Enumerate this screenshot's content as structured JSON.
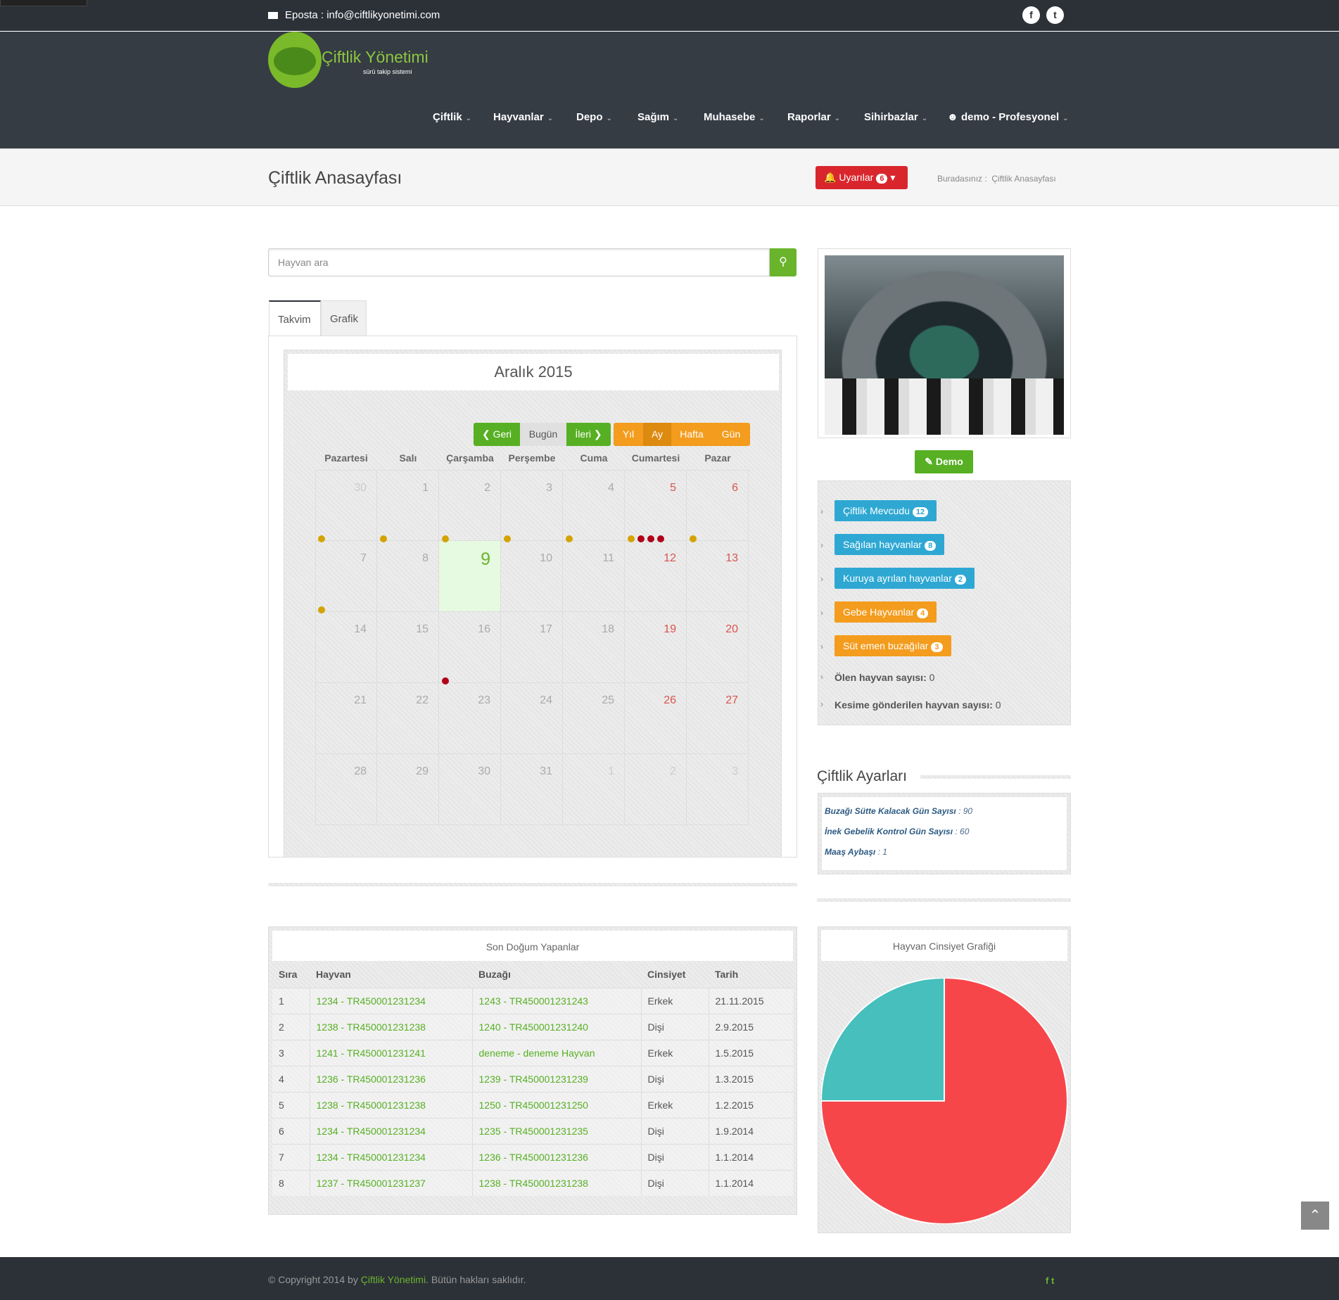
{
  "topbar": {
    "email_label": "Eposta : info@ciftlikyonetimi.com",
    "social": [
      "f",
      "t"
    ]
  },
  "logo": {
    "title": "Çiftlik Yönetimi",
    "subtitle": "sürü takip sistemi"
  },
  "nav": {
    "items": [
      {
        "label": "Çiftlik"
      },
      {
        "label": "Hayvanlar"
      },
      {
        "label": "Depo"
      },
      {
        "label": "Sağım"
      },
      {
        "label": "Muhasebe"
      },
      {
        "label": "Raporlar"
      },
      {
        "label": "Sihirbazlar"
      },
      {
        "label": "demo - Profesyonel"
      }
    ]
  },
  "subheader": {
    "page_title": "Çiftlik Anasayfası",
    "alerts_label": "Uyarılar",
    "alerts_count": "6",
    "breadcrumb_prefix": "Buradasınız :",
    "breadcrumb_current": "Çiftlik Anasayfası"
  },
  "search": {
    "placeholder": "Hayvan ara"
  },
  "tabs": [
    {
      "label": "Takvim"
    },
    {
      "label": "Grafik"
    }
  ],
  "calendar": {
    "title": "Aralık 2015",
    "nav_buttons": {
      "prev": "Geri",
      "today": "Bugün",
      "next": "İleri"
    },
    "view_buttons": {
      "year": "Yıl",
      "month": "Ay",
      "week": "Hafta",
      "day": "Gün"
    },
    "weekdays": [
      "Pazartesi",
      "Salı",
      "Çarşamba",
      "Perşembe",
      "Cuma",
      "Cumartesi",
      "Pazar"
    ],
    "weeks": [
      [
        "30",
        "1",
        "2",
        "3",
        "4",
        "5",
        "6"
      ],
      [
        "7",
        "8",
        "9",
        "10",
        "11",
        "12",
        "13"
      ],
      [
        "14",
        "15",
        "16",
        "17",
        "18",
        "19",
        "20"
      ],
      [
        "21",
        "22",
        "23",
        "24",
        "25",
        "26",
        "27"
      ],
      [
        "28",
        "29",
        "30",
        "31",
        "1",
        "2",
        "3"
      ]
    ],
    "today": "9"
  },
  "right_panel": {
    "demo_button": "Demo",
    "stats": [
      {
        "label": "Çiftlik Mevcudu",
        "count": "12"
      },
      {
        "label": "Sağılan hayvanlar",
        "count": "8"
      },
      {
        "label": "Kuruya ayrılan hayvanlar",
        "count": "2"
      },
      {
        "label": "Gebe Hayvanlar",
        "count": "4"
      },
      {
        "label": "Süt emen buzağılar",
        "count": "3"
      }
    ],
    "dead_label": "Ölen hayvan sayısı:",
    "dead_value": "0",
    "slaughter_label": "Kesime gönderilen hayvan sayısı:",
    "slaughter_value": "0",
    "colors": {
      "blue": "#2ea8d3",
      "orange": "#f39c1d",
      "green": "#57b023"
    }
  },
  "settings": {
    "title": "Çiftlik Ayarları",
    "items": [
      {
        "label": "Buzağı Sütte Kalacak Gün Sayısı",
        "value": ": 90"
      },
      {
        "label": "İnek Gebelik Kontrol Gün Sayısı",
        "value": ": 60"
      },
      {
        "label": "Maaş Aybaşı",
        "value": ": 1"
      }
    ]
  },
  "births": {
    "title": "Son Doğum Yapanlar",
    "columns": [
      "Sıra",
      "Hayvan",
      "Buzağı",
      "Cinsiyet",
      "Tarih"
    ],
    "rows": [
      [
        "1",
        "1234 - TR450001231234",
        "1243 - TR450001231243",
        "Erkek",
        "21.11.2015"
      ],
      [
        "2",
        "1238 - TR450001231238",
        "1240 - TR450001231240",
        "Dişi",
        "2.9.2015"
      ],
      [
        "3",
        "1241 - TR450001231241",
        "deneme - deneme Hayvan",
        "Erkek",
        "1.5.2015"
      ],
      [
        "4",
        "1236 - TR450001231236",
        "1239 - TR450001231239",
        "Dişi",
        "1.3.2015"
      ],
      [
        "5",
        "1238 - TR450001231238",
        "1250 - TR450001231250",
        "Erkek",
        "1.2.2015"
      ],
      [
        "6",
        "1234 - TR450001231234",
        "1235 - TR450001231235",
        "Dişi",
        "1.9.2014"
      ],
      [
        "7",
        "1234 - TR450001231234",
        "1236 - TR450001231236",
        "Dişi",
        "1.1.2014"
      ],
      [
        "8",
        "1237 - TR450001231237",
        "1238 - TR450001231238",
        "Dişi",
        "1.1.2014"
      ]
    ]
  },
  "chart_data": {
    "type": "pie",
    "title": "Hayvan Cinsiyet Grafiği",
    "values": [
      75,
      25
    ],
    "colors": [
      "#f7464a",
      "#46bfbd"
    ]
  },
  "footer": {
    "copyright_prefix": "© Copyright 2014 by",
    "brand": "Çiftlik Yönetimi",
    "copyright_suffix": ". Bütün hakları saklıdır."
  }
}
